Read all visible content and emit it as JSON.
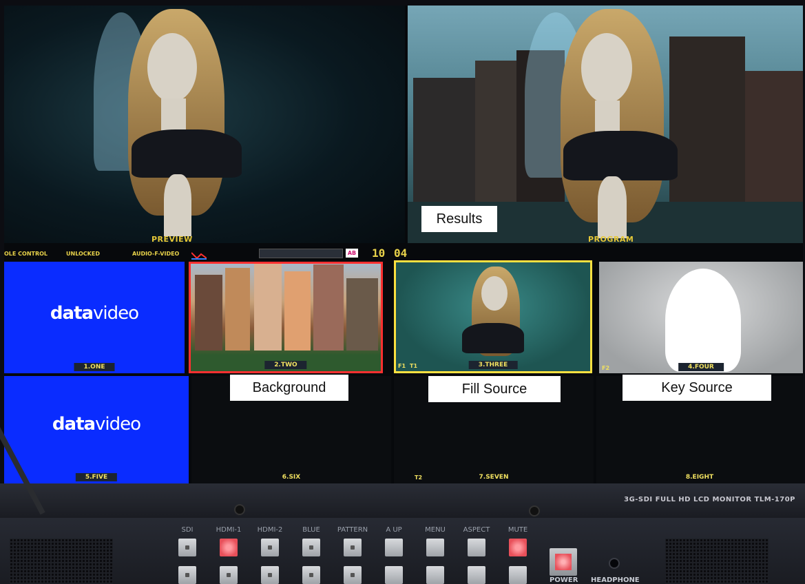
{
  "multiview": {
    "preview_label": "PREVIEW",
    "program_label": "PROGRAM",
    "status": {
      "console_control": "OLE CONTROL",
      "lock_state": "UNLOCKED",
      "audio_mode": "AUDIO-F-VIDEO",
      "time_hours": "10",
      "time_minutes": "04",
      "transition_icon": "AB"
    },
    "tiles": [
      {
        "name": "1.ONE",
        "logo_bold": "data",
        "logo_lite": "video"
      },
      {
        "name": "2.TWO"
      },
      {
        "name": "3.THREE",
        "tag": "F1",
        "tag2": "T1"
      },
      {
        "name": "4.FOUR",
        "tag": "F2"
      },
      {
        "name": "5.FIVE",
        "logo_bold": "data",
        "logo_lite": "video"
      },
      {
        "name": "6.SIX"
      },
      {
        "name": "7.SEVEN",
        "tag": "T2"
      },
      {
        "name": "8.EIGHT"
      }
    ]
  },
  "callouts": {
    "results": "Results",
    "background": "Background",
    "fill_source": "Fill Source",
    "key_source": "Key Source"
  },
  "monitor": {
    "model": "3G-SDI FULL HD LCD MONITOR TLM-170P",
    "buttons": [
      "SDI",
      "HDMI-1",
      "HDMI-2",
      "BLUE",
      "PATTERN",
      "A UP",
      "MENU",
      "ASPECT",
      "MUTE"
    ],
    "lit_buttons": [
      "HDMI-1",
      "MUTE"
    ],
    "power_label": "POWER",
    "headphone_label": "HEADPHONE"
  },
  "colors": {
    "tally_red": "#ff3030",
    "tally_yellow": "#ffe040",
    "label_yellow": "#e6c838",
    "logo_blue": "#0a2cff"
  }
}
